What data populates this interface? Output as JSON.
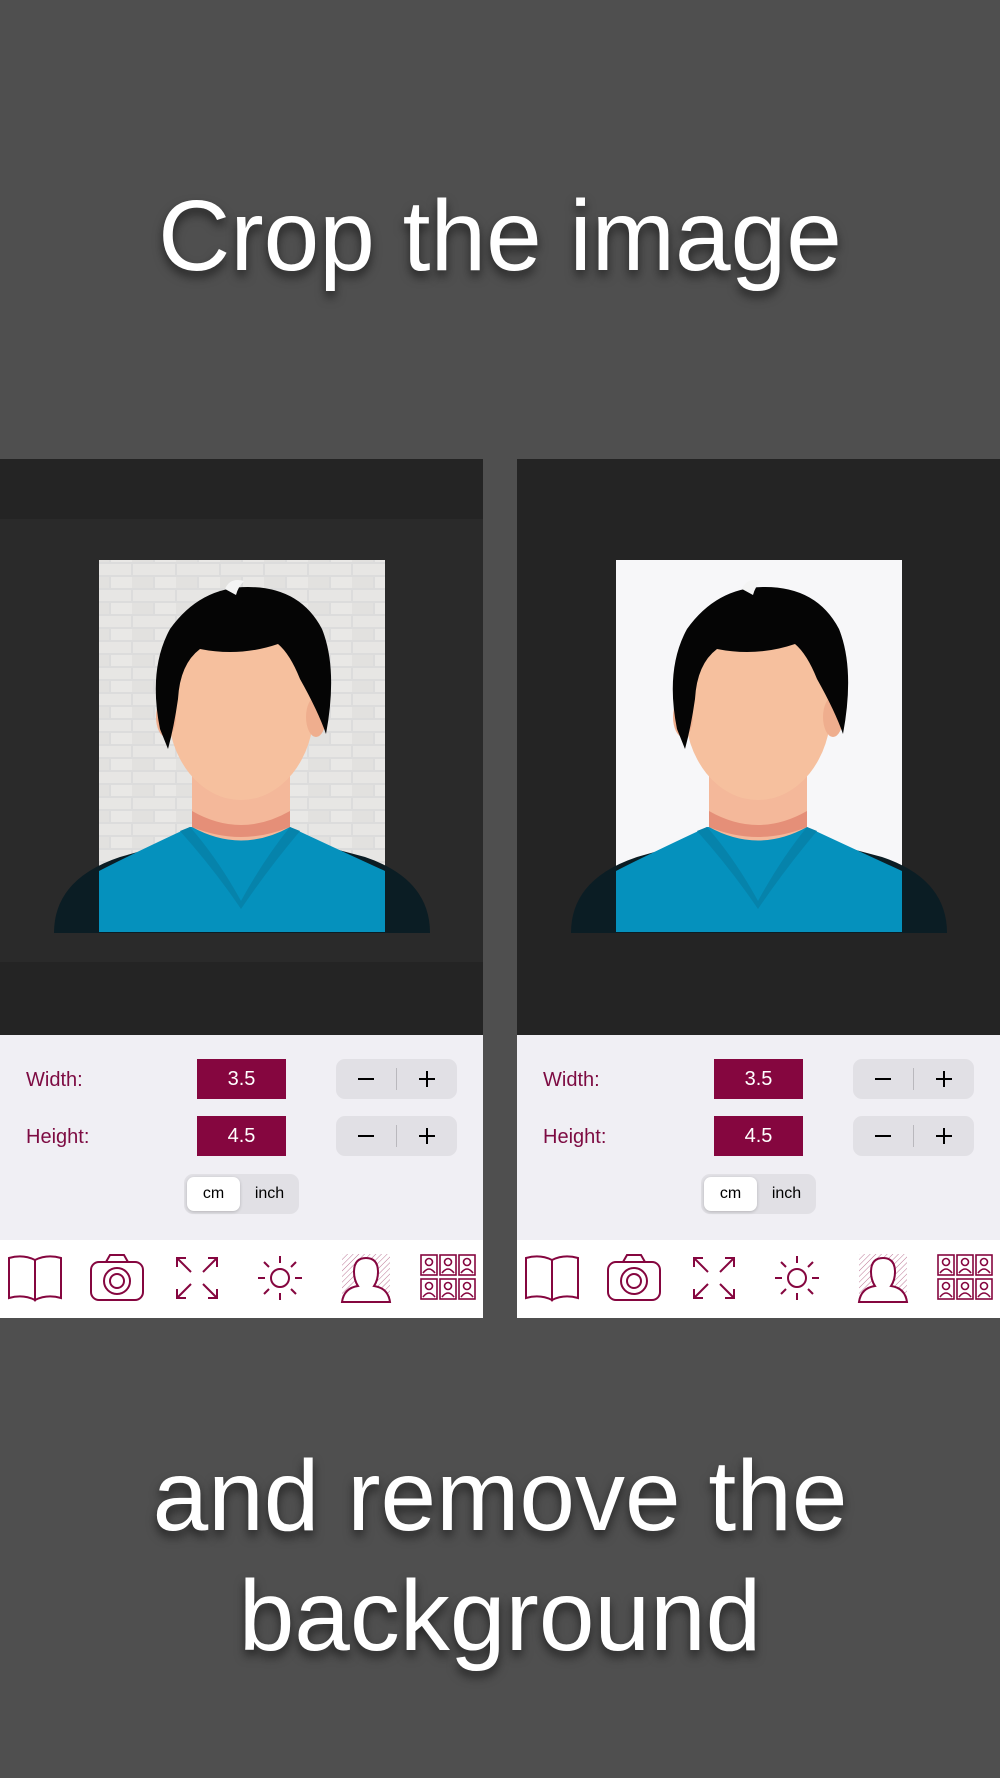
{
  "headline_top": "Crop the image",
  "headline_bottom_line1": "and remove the",
  "headline_bottom_line2": "background",
  "accent_color": "#85063f",
  "panels": [
    {
      "variant": "original background (brick wall)",
      "width_label": "Width:",
      "width_value": "3.5",
      "height_label": "Height:",
      "height_value": "4.5",
      "unit_options": [
        "cm",
        "inch"
      ],
      "selected_unit": "cm",
      "toolbar_icons": [
        "book-icon",
        "camera-icon",
        "expand-icon",
        "brightness-icon",
        "portrait-icon",
        "photo-grid-icon"
      ]
    },
    {
      "variant": "background removed (white)",
      "width_label": "Width:",
      "width_value": "3.5",
      "height_label": "Height:",
      "height_value": "4.5",
      "unit_options": [
        "cm",
        "inch"
      ],
      "selected_unit": "cm",
      "toolbar_icons": [
        "book-icon",
        "camera-icon",
        "expand-icon",
        "brightness-icon",
        "portrait-icon",
        "photo-grid-icon"
      ]
    }
  ]
}
